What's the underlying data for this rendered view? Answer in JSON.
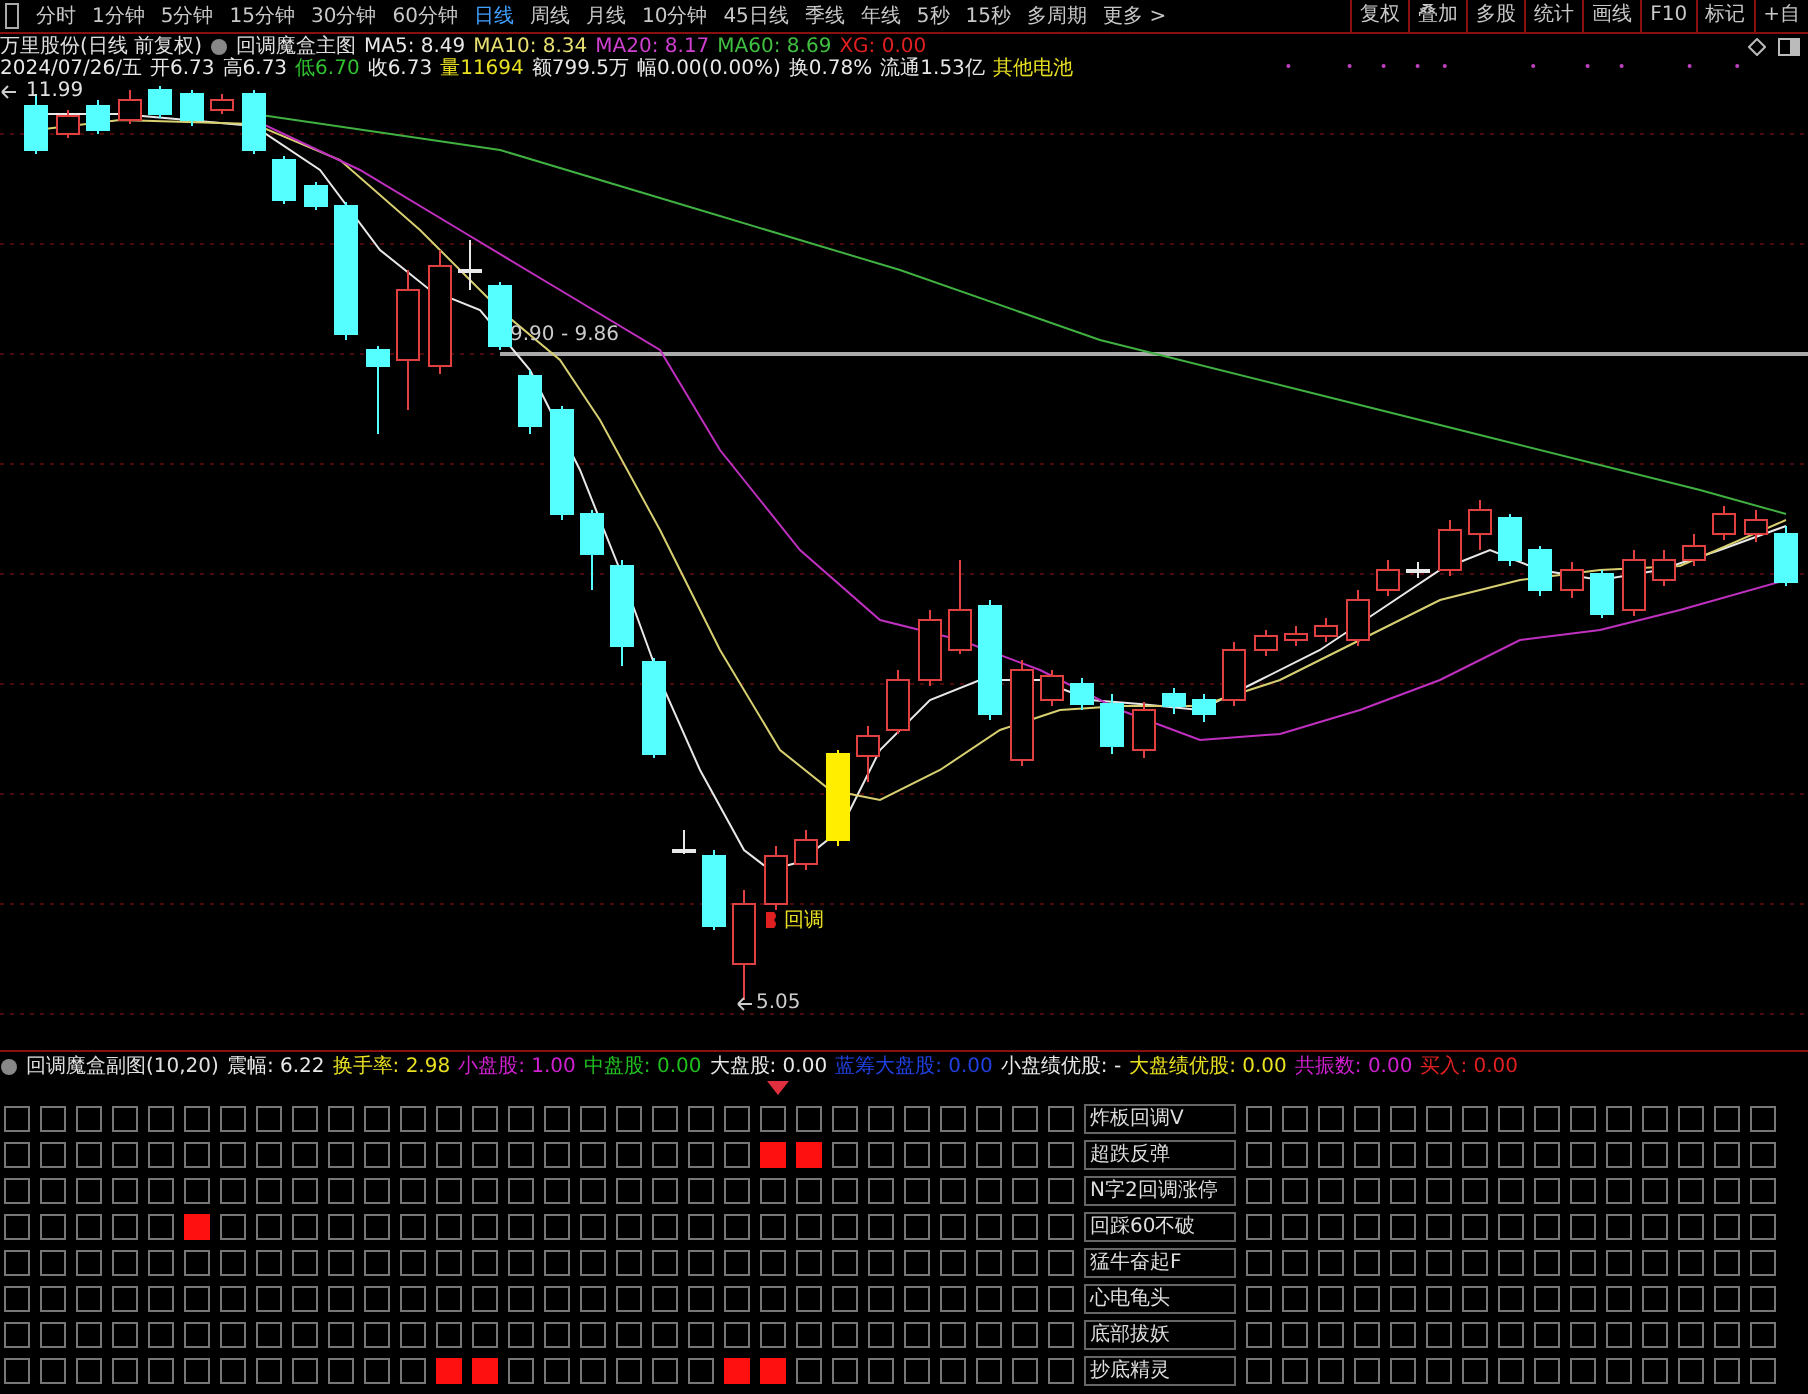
{
  "toolbar": {
    "periods": [
      {
        "label": "分时",
        "selected": false
      },
      {
        "label": "1分钟",
        "selected": false
      },
      {
        "label": "5分钟",
        "selected": false
      },
      {
        "label": "15分钟",
        "selected": false
      },
      {
        "label": "30分钟",
        "selected": false
      },
      {
        "label": "60分钟",
        "selected": false
      },
      {
        "label": "日线",
        "selected": true
      },
      {
        "label": "周线",
        "selected": false
      },
      {
        "label": "月线",
        "selected": false
      },
      {
        "label": "10分钟",
        "selected": false
      },
      {
        "label": "45日线",
        "selected": false
      },
      {
        "label": "季线",
        "selected": false
      },
      {
        "label": "年线",
        "selected": false
      },
      {
        "label": "5秒",
        "selected": false
      },
      {
        "label": "15秒",
        "selected": false
      },
      {
        "label": "多周期",
        "selected": false
      },
      {
        "label": "更多 >",
        "selected": false
      }
    ],
    "tools": [
      "复权",
      "叠加",
      "多股",
      "统计",
      "画线",
      "F10",
      "标记",
      "+自"
    ]
  },
  "header": {
    "stock": "万里股份(日线 前复权)",
    "main_indicator": "回调魔盒主图",
    "ma": [
      {
        "text": "MA5: 8.49",
        "color": "#e8e8e8"
      },
      {
        "text": "MA10: 8.34",
        "color": "#e8e070"
      },
      {
        "text": "MA20: 8.17",
        "color": "#d040d0"
      },
      {
        "text": "MA60: 8.69",
        "color": "#40c040"
      },
      {
        "text": "XG: 0.00",
        "color": "#e02020"
      }
    ]
  },
  "quote": [
    {
      "text": "2024/07/26/五",
      "color": "#e8e8e8"
    },
    {
      "text": "开6.73",
      "color": "#e8e8e8"
    },
    {
      "text": "高6.73",
      "color": "#e8e8e8"
    },
    {
      "text": "低6.70",
      "color": "#30c030"
    },
    {
      "text": "收6.73",
      "color": "#e8e8e8"
    },
    {
      "text": "量11694",
      "color": "#e8e020"
    },
    {
      "text": "额799.5万",
      "color": "#e8e8e8"
    },
    {
      "text": "幅0.00(0.00%)",
      "color": "#e8e8e8"
    },
    {
      "text": "换0.78%",
      "color": "#e8e8e8"
    },
    {
      "text": "流通1.53亿",
      "color": "#e8e8e8"
    },
    {
      "text": "其他电池",
      "color": "#e8e020"
    }
  ],
  "chart": {
    "high_label": "11.99",
    "range_label": "9.90 - 9.86",
    "signal_label": "回调",
    "low_label": "5.05"
  },
  "sub_indicator": {
    "title": "回调魔盒副图(10,20)",
    "values": [
      {
        "text": "震幅: 6.22",
        "color": "#e8e8e8"
      },
      {
        "text": "换手率: 2.98",
        "color": "#e8e020"
      },
      {
        "text": "小盘股: 1.00",
        "color": "#d020d0"
      },
      {
        "text": "中盘股: 0.00",
        "color": "#20c020"
      },
      {
        "text": "大盘股: 0.00",
        "color": "#e8e8e8"
      },
      {
        "text": "蓝筹大盘股: 0.00",
        "color": "#2040e0"
      },
      {
        "text": "小盘绩优股: -",
        "color": "#e8e8e8"
      },
      {
        "text": "大盘绩优股: 0.00",
        "color": "#e8e020"
      },
      {
        "text": "共振数: 0.00",
        "color": "#d020d0"
      },
      {
        "text": "买入: 0.00",
        "color": "#e02020"
      }
    ]
  },
  "signals": [
    {
      "label": "炸板回调V",
      "cells": [
        false,
        false,
        false,
        false,
        false,
        false,
        false,
        false,
        false,
        false,
        false,
        false,
        false,
        false,
        false,
        false,
        false,
        false,
        false,
        false,
        false,
        false,
        false,
        false,
        false,
        false,
        false,
        false,
        false,
        false,
        false,
        false,
        false,
        false,
        false,
        false,
        false,
        false,
        false,
        false,
        false,
        false,
        false,
        false,
        false
      ]
    },
    {
      "label": "超跌反弹",
      "cells": [
        false,
        false,
        false,
        false,
        false,
        false,
        false,
        false,
        false,
        false,
        false,
        false,
        false,
        false,
        false,
        false,
        false,
        false,
        false,
        false,
        false,
        true,
        true,
        false,
        false,
        false,
        false,
        false,
        false,
        false,
        false,
        false,
        false,
        false,
        false,
        false,
        false,
        false,
        false,
        false,
        false,
        false,
        false,
        false,
        false
      ]
    },
    {
      "label": "N字2回调涨停",
      "cells": [
        false,
        false,
        false,
        false,
        false,
        false,
        false,
        false,
        false,
        false,
        false,
        false,
        false,
        false,
        false,
        false,
        false,
        false,
        false,
        false,
        false,
        false,
        false,
        false,
        false,
        false,
        false,
        false,
        false,
        false,
        false,
        false,
        false,
        false,
        false,
        false,
        false,
        false,
        false,
        false,
        false,
        false,
        false,
        false,
        false
      ]
    },
    {
      "label": "回踩60不破",
      "cells": [
        false,
        false,
        false,
        false,
        false,
        true,
        false,
        false,
        false,
        false,
        false,
        false,
        false,
        false,
        false,
        false,
        false,
        false,
        false,
        false,
        false,
        false,
        false,
        false,
        false,
        false,
        false,
        false,
        false,
        false,
        false,
        false,
        false,
        false,
        false,
        false,
        false,
        false,
        false,
        false,
        false,
        false,
        false,
        false,
        false
      ]
    },
    {
      "label": "猛牛奋起F",
      "cells": [
        false,
        false,
        false,
        false,
        false,
        false,
        false,
        false,
        false,
        false,
        false,
        false,
        false,
        false,
        false,
        false,
        false,
        false,
        false,
        false,
        false,
        false,
        false,
        false,
        false,
        false,
        false,
        false,
        false,
        false,
        false,
        false,
        false,
        false,
        false,
        false,
        false,
        false,
        false,
        false,
        false,
        false,
        false,
        false,
        false
      ]
    },
    {
      "label": "心电龟头",
      "cells": [
        false,
        false,
        false,
        false,
        false,
        false,
        false,
        false,
        false,
        false,
        false,
        false,
        false,
        false,
        false,
        false,
        false,
        false,
        false,
        false,
        false,
        false,
        false,
        false,
        false,
        false,
        false,
        false,
        false,
        false,
        false,
        false,
        false,
        false,
        false,
        false,
        false,
        false,
        false,
        false,
        false,
        false,
        false,
        false,
        false
      ]
    },
    {
      "label": "底部拔妖",
      "cells": [
        false,
        false,
        false,
        false,
        false,
        false,
        false,
        false,
        false,
        false,
        false,
        false,
        false,
        false,
        false,
        false,
        false,
        false,
        false,
        false,
        false,
        false,
        false,
        false,
        false,
        false,
        false,
        false,
        false,
        false,
        false,
        false,
        false,
        false,
        false,
        false,
        false,
        false,
        false,
        false,
        false,
        false,
        false,
        false,
        false
      ]
    },
    {
      "label": "抄底精灵",
      "cells": [
        false,
        false,
        false,
        false,
        false,
        false,
        false,
        false,
        false,
        false,
        false,
        false,
        true,
        true,
        false,
        false,
        false,
        false,
        false,
        false,
        true,
        true,
        false,
        false,
        false,
        false,
        false,
        false,
        false,
        false,
        false,
        false,
        false,
        false,
        false,
        false,
        false,
        false,
        false,
        false,
        false,
        false,
        false,
        false,
        false
      ]
    }
  ]
}
